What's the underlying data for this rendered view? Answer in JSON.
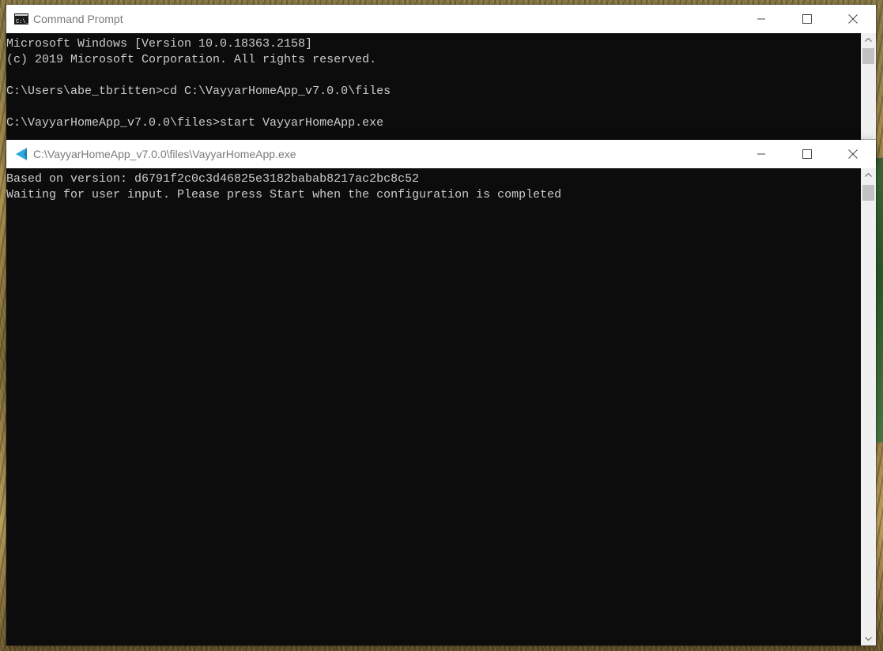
{
  "cmd_window": {
    "title": "Command Prompt",
    "lines": [
      "Microsoft Windows [Version 10.0.18363.2158]",
      "(c) 2019 Microsoft Corporation. All rights reserved.",
      "",
      "C:\\Users\\abe_tbritten>cd C:\\VayyarHomeApp_v7.0.0\\files",
      "",
      "C:\\VayyarHomeApp_v7.0.0\\files>start VayyarHomeApp.exe"
    ]
  },
  "app_window": {
    "title": "C:\\VayyarHomeApp_v7.0.0\\files\\VayyarHomeApp.exe",
    "lines": [
      "Based on version: d6791f2c0c3d46825e3182babab8217ac2bc8c52",
      "Waiting for user input. Please press Start when the configuration is completed"
    ]
  },
  "icons": {
    "cmd": "command-prompt-icon",
    "app": "vayyar-app-icon",
    "minimize": "minimize-icon",
    "maximize": "maximize-icon",
    "close": "close-icon"
  },
  "colors": {
    "console_bg": "#0c0c0c",
    "console_text": "#cccccc",
    "app_icon": "#29a8e0"
  }
}
